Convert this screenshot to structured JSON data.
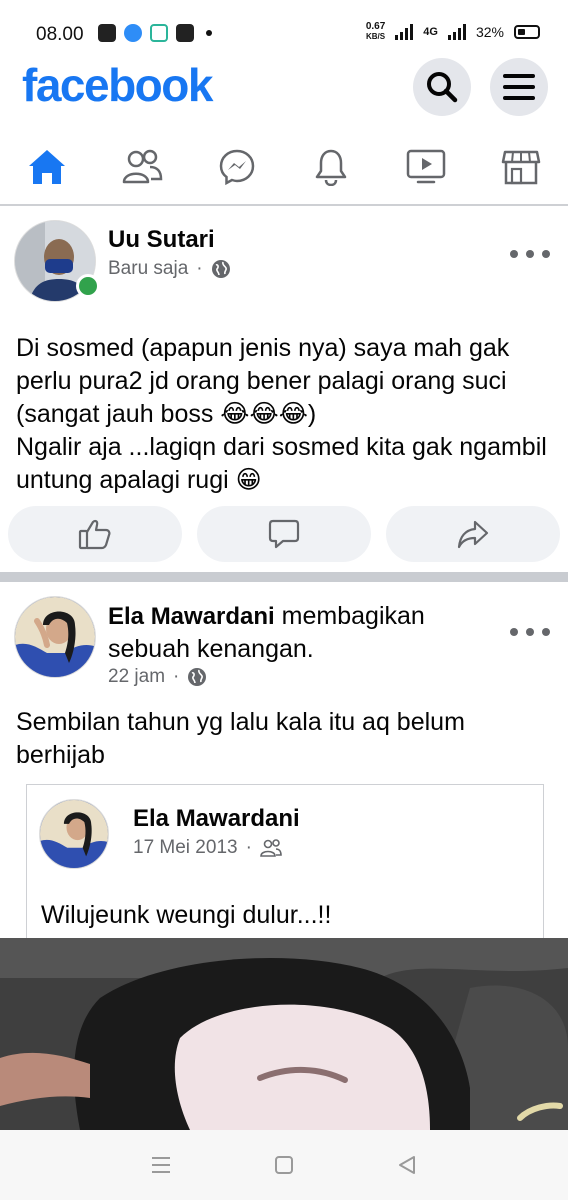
{
  "status_bar": {
    "time": "08.00",
    "speed_value": "0.67",
    "speed_unit": "KB/S",
    "network": "4G",
    "battery": "32%"
  },
  "header": {
    "logo": "facebook",
    "brand_color": "#1877f2"
  },
  "nav_tabs": [
    {
      "name": "home-icon",
      "active": true
    },
    {
      "name": "friends-icon"
    },
    {
      "name": "messenger-icon"
    },
    {
      "name": "notifications-bell-icon"
    },
    {
      "name": "watch-video-icon"
    },
    {
      "name": "marketplace-store-icon"
    }
  ],
  "post1": {
    "author": "Uu Sutari",
    "time": "Baru saja",
    "audience_icon": "globe-icon",
    "text": "Di sosmed (apapun jenis nya) saya mah gak perlu pura2 jd orang bener palagi orang suci (sangat jauh boss 😂😂😂)\nNgalir aja ...lagiqn dari sosmed kita gak ngambil untung apalagi rugi 😁",
    "actions": [
      "like-icon",
      "comment-icon",
      "share-icon"
    ]
  },
  "post2": {
    "author": "Ela Mawardani",
    "action_text": " membagikan sebuah kenangan.",
    "time": "22 jam",
    "audience_icon": "globe-icon",
    "text": "Sembilan tahun yg lalu kala itu aq belum berhijab",
    "shared": {
      "author": "Ela Mawardani",
      "date": "17 Mei 2013",
      "audience_icon": "friends-icon",
      "text": "Wilujeunk weungi dulur...!!"
    }
  },
  "system_nav": [
    "recent-apps-icon",
    "home-button-icon",
    "back-icon"
  ]
}
